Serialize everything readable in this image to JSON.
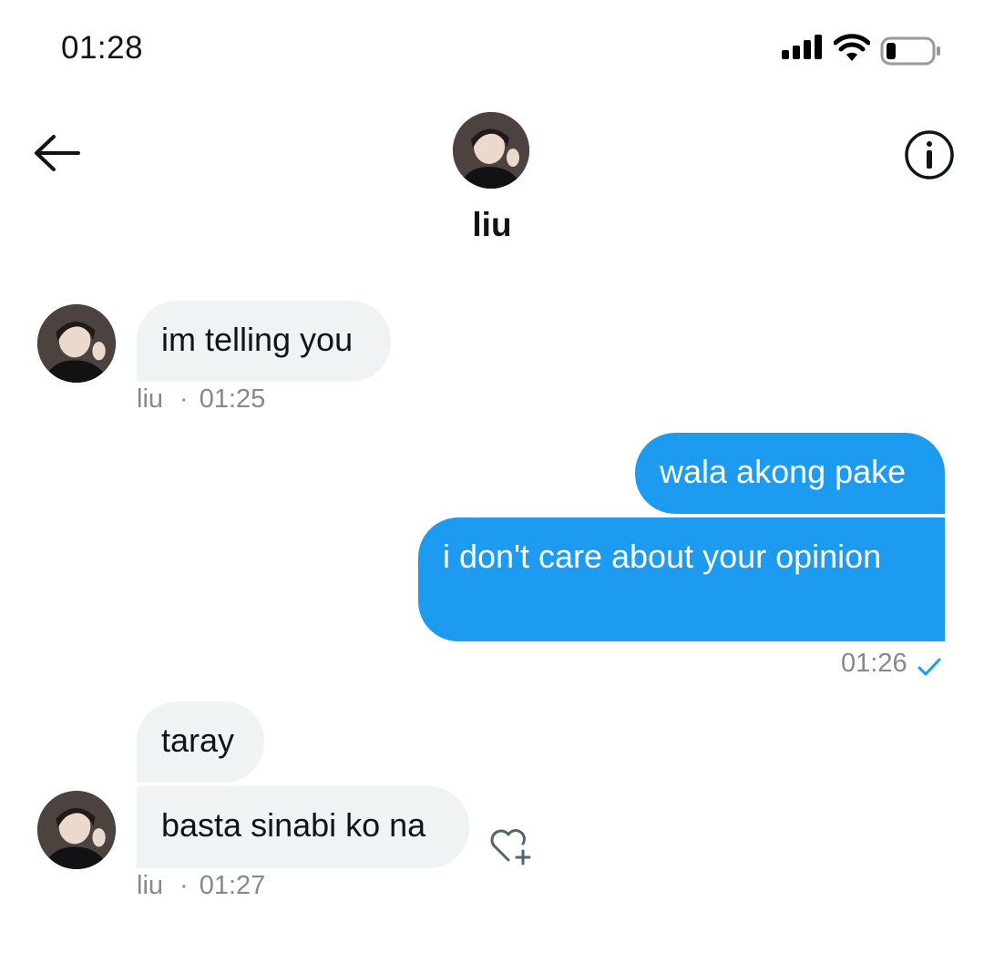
{
  "status_bar": {
    "time": "01:28"
  },
  "header": {
    "name": "liu"
  },
  "messages": {
    "m1": {
      "text": "im telling you",
      "sender": "liu",
      "time": "01:25"
    },
    "m2": {
      "text": "wala akong pake"
    },
    "m3": {
      "text": "i don't care about your opinion"
    },
    "m3_meta": {
      "time": "01:26"
    },
    "m4": {
      "text": "taray"
    },
    "m5": {
      "text": "basta sinabi ko na",
      "sender": "liu",
      "time": "01:27"
    }
  },
  "colors": {
    "accent": "#1d9bf0",
    "incoming_bubble": "#eff3f4",
    "meta_text": "#86888a"
  },
  "icons": [
    "signal-icon",
    "wifi-icon",
    "battery-icon",
    "back-arrow-icon",
    "info-icon",
    "add-reaction-icon"
  ]
}
